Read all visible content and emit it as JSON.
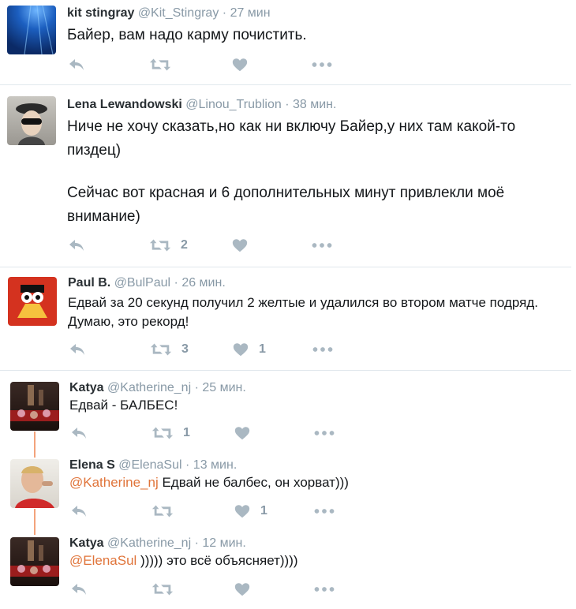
{
  "tweets": [
    {
      "name": "kit stingray",
      "handle": "@Kit_Stingray",
      "dot": "·",
      "time": "27 мин",
      "text": "Байер, вам надо карму почистить.",
      "retweets": "",
      "likes": ""
    },
    {
      "name": "Lena Lewandowski",
      "handle": "@Linou_Trublion",
      "dot": "·",
      "time": "38 мин.",
      "text_line1": "Ниче не хочу сказать,но как ни включу Байер,у них там какой-то",
      "text_line2": "пиздец)",
      "text_line3": "Сейчас вот красная и 6 дополнительных минут привлекли моё",
      "text_line4": "внимание)",
      "retweets": "2",
      "likes": ""
    },
    {
      "name": "Paul B.",
      "handle": "@BulPaul",
      "dot": "·",
      "time": "26 мин.",
      "text_line1": "Едвай за 20 секунд получил 2 желтые и удалился во втором матче подряд.",
      "text_line2": "Думаю, это рекорд!",
      "retweets": "3",
      "likes": "1"
    },
    {
      "name": "Katya",
      "handle": "@Katherine_nj",
      "dot": "·",
      "time": "25 мин.",
      "text": "Едвай - БАЛБЕС!",
      "retweets": "1",
      "likes": ""
    },
    {
      "name": "Elena S",
      "handle": "@ElenaSul",
      "dot": "·",
      "time": "13 мин.",
      "mention": "@Katherine_nj",
      "text": " Едвай не балбес, он хорват)))",
      "retweets": "",
      "likes": "1"
    },
    {
      "name": "Katya",
      "handle": "@Katherine_nj",
      "dot": "·",
      "time": "12 мин.",
      "mention": "@ElenaSul",
      "text": " ))))) это всё объясняет))))",
      "retweets": "",
      "likes": ""
    }
  ],
  "colors": {
    "name": "#292f33",
    "meta": "#8899a6",
    "icon": "#aab8c2",
    "mention": "#e0743a",
    "thread": "#f3a37b"
  },
  "icons": [
    "reply-icon",
    "retweet-icon",
    "like-icon",
    "more-icon"
  ]
}
